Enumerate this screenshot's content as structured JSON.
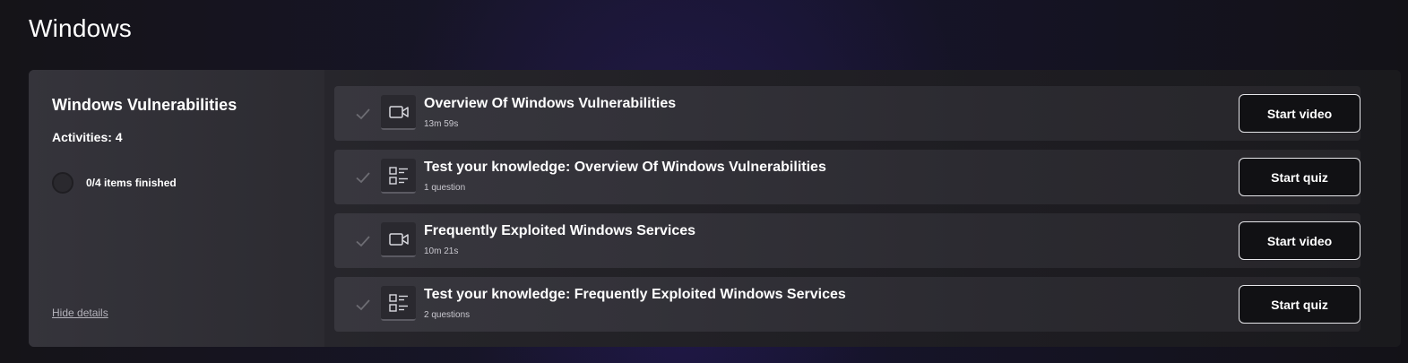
{
  "page": {
    "title": "Windows"
  },
  "module": {
    "title": "Windows Vulnerabilities",
    "activities_label": "Activities: 4",
    "progress_text": "0/4 items finished",
    "progress_fraction": 0,
    "hide_details_label": "Hide details"
  },
  "activities": [
    {
      "type": "video",
      "icon": "video-camera-icon",
      "title": "Overview Of Windows Vulnerabilities",
      "meta": "13m 59s",
      "button": "Start video"
    },
    {
      "type": "quiz",
      "icon": "quiz-list-icon",
      "title": "Test your knowledge: Overview Of Windows Vulnerabilities",
      "meta": "1 question",
      "button": "Start quiz"
    },
    {
      "type": "video",
      "icon": "video-camera-icon",
      "title": "Frequently Exploited Windows Services",
      "meta": "10m 21s",
      "button": "Start video"
    },
    {
      "type": "quiz",
      "icon": "quiz-list-icon",
      "title": "Test your knowledge: Frequently Exploited Windows Services",
      "meta": "2 questions",
      "button": "Start quiz"
    }
  ],
  "colors": {
    "check": "#6d6c73",
    "icon_stroke": "#d8d8de"
  }
}
